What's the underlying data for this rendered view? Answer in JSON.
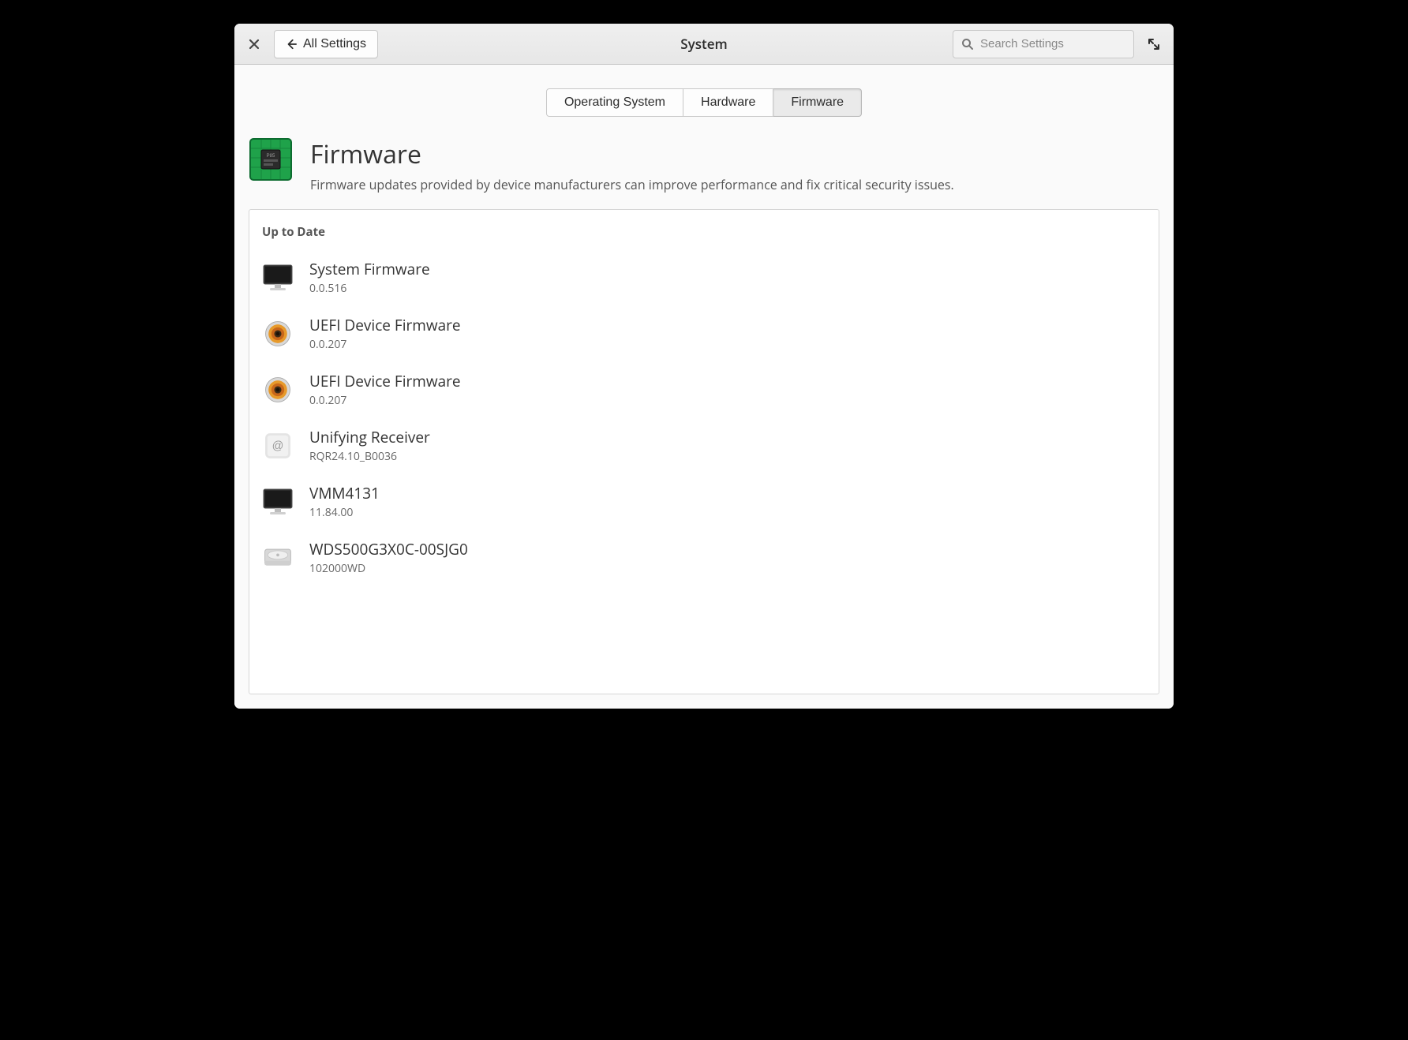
{
  "header": {
    "title": "System",
    "back_label": "All Settings",
    "search_placeholder": "Search Settings"
  },
  "tabs": [
    {
      "label": "Operating System",
      "active": false
    },
    {
      "label": "Hardware",
      "active": false
    },
    {
      "label": "Firmware",
      "active": true
    }
  ],
  "page": {
    "title": "Firmware",
    "subtitle": "Firmware updates provided by device manufacturers can improve performance and fix critical security issues."
  },
  "section": {
    "title": "Up to Date",
    "devices": [
      {
        "name": "System Firmware",
        "version": "0.0.516",
        "icon": "monitor"
      },
      {
        "name": "UEFI Device Firmware",
        "version": "0.0.207",
        "icon": "speaker"
      },
      {
        "name": "UEFI Device Firmware",
        "version": "0.0.207",
        "icon": "speaker"
      },
      {
        "name": "Unifying Receiver",
        "version": "RQR24.10_B0036",
        "icon": "receiver"
      },
      {
        "name": "VMM4131",
        "version": "11.84.00",
        "icon": "monitor"
      },
      {
        "name": "WDS500G3X0C-00SJG0",
        "version": "102000WD",
        "icon": "drive"
      }
    ]
  }
}
